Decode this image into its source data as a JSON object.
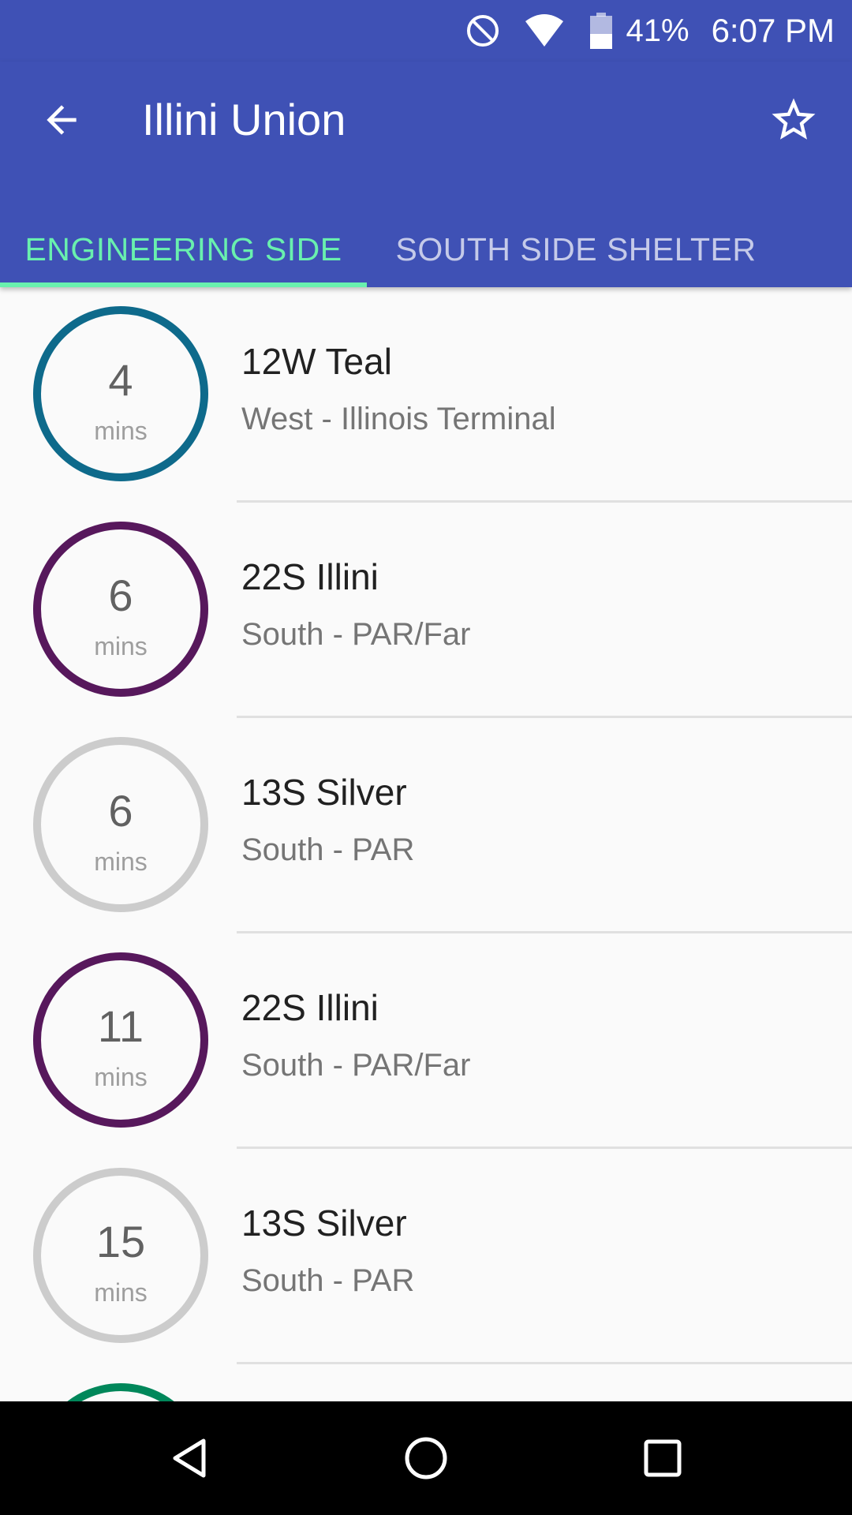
{
  "status": {
    "battery": "41%",
    "time": "6:07 PM"
  },
  "appbar": {
    "title": "Illini Union",
    "icons": [
      "arrow-left-icon",
      "star-outline-icon"
    ]
  },
  "tabs": [
    {
      "label": "ENGINEERING SIDE",
      "selected": true
    },
    {
      "label": "SOUTH SIDE SHELTER",
      "selected": false
    }
  ],
  "colors": {
    "primary": "#3f51b5",
    "accent": "#69f0ae",
    "teal": "#0e6a8b",
    "illini": "#57185c",
    "silver": "#cccccc",
    "green": "#00875a"
  },
  "departures": [
    {
      "minutes": "4",
      "unit": "mins",
      "route": "12W Teal",
      "direction": "West - Illinois Terminal",
      "color": "#0e6a8b"
    },
    {
      "minutes": "6",
      "unit": "mins",
      "route": "22S Illini",
      "direction": "South - PAR/Far",
      "color": "#57185c"
    },
    {
      "minutes": "6",
      "unit": "mins",
      "route": "13S Silver",
      "direction": "South - PAR",
      "color": "#cccccc"
    },
    {
      "minutes": "11",
      "unit": "mins",
      "route": "22S Illini",
      "direction": "South - PAR/Far",
      "color": "#57185c"
    },
    {
      "minutes": "15",
      "unit": "mins",
      "route": "13S Silver",
      "direction": "South - PAR",
      "color": "#cccccc"
    },
    {
      "minutes": "",
      "unit": "",
      "route": "",
      "direction": "",
      "color": "#00875a"
    }
  ],
  "navbar": {
    "icons": [
      "nav-back-icon",
      "nav-home-icon",
      "nav-recents-icon"
    ]
  }
}
